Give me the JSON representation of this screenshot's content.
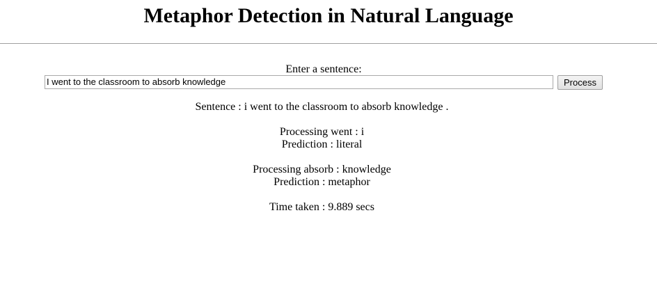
{
  "page": {
    "title": "Metaphor Detection in Natural Language"
  },
  "form": {
    "label": "Enter a sentence:",
    "input_value": "I went to the classroom to absorb knowledge",
    "submit_label": "Process"
  },
  "results": {
    "sentence": "Sentence : i went to the classroom to absorb knowledge .",
    "items": [
      {
        "processing": "Processing went : i",
        "prediction": "Prediction : literal"
      },
      {
        "processing": "Processing absorb : knowledge",
        "prediction": "Prediction : metaphor"
      }
    ],
    "time_taken": "Time taken : 9.889 secs"
  }
}
